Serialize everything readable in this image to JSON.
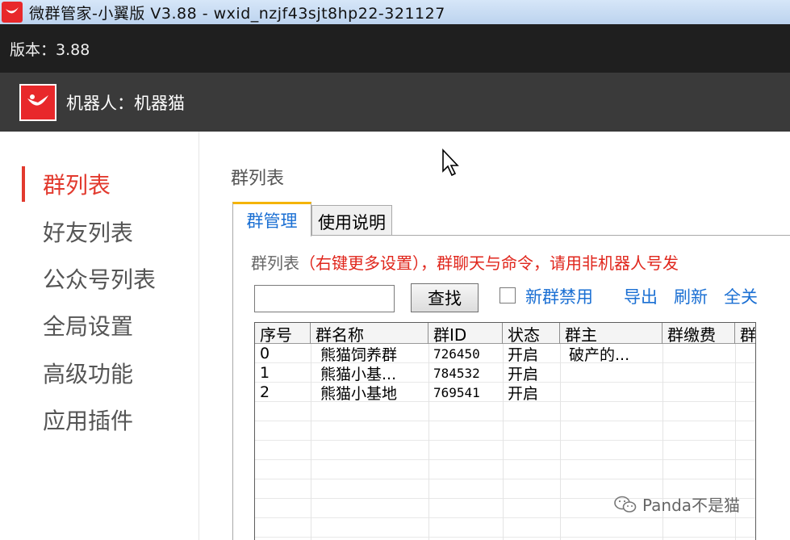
{
  "window": {
    "title": "微群管家-小翼版 V3.88 - wxid_nzjf43sjt8hp22-321127",
    "icon": "heart-logo-icon",
    "brand_color": "#e8282b"
  },
  "version_bar": {
    "label": "版本：3.88"
  },
  "robot_bar": {
    "label": "机器人：机器猫",
    "logo": "heart-logo-icon"
  },
  "sidebar": {
    "items": [
      {
        "label": "群列表",
        "active": true
      },
      {
        "label": "好友列表"
      },
      {
        "label": "公众号列表"
      },
      {
        "label": "全局设置"
      },
      {
        "label": "高级功能"
      },
      {
        "label": "应用插件"
      }
    ]
  },
  "main": {
    "title": "群列表",
    "tabs": [
      {
        "label": "群管理",
        "active": true
      },
      {
        "label": "使用说明"
      }
    ],
    "hint_prefix": "群列表",
    "hint_red": "（右键更多设置），群聊天与命令，请用非机器人号发",
    "search": {
      "value": "",
      "placeholder": ""
    },
    "find_label": "查找",
    "checkbox": {
      "label": "新群禁用",
      "checked": false
    },
    "links": {
      "export": "导出",
      "refresh": "刷新",
      "close_all": "全关"
    }
  },
  "table": {
    "columns": [
      "序号",
      "群名称",
      "群ID",
      "状态",
      "群主",
      "群缴费",
      "群"
    ],
    "rows": [
      [
        "0",
        "熊猫饲养群",
        "726450",
        "开启",
        "破产的...",
        "",
        ""
      ],
      [
        "1",
        "熊猫小基...",
        "784532",
        "开启",
        "",
        "",
        ""
      ],
      [
        "2",
        "熊猫小基地",
        "769541",
        "开启",
        "",
        "",
        ""
      ]
    ]
  },
  "watermark": {
    "text": "Panda不是猫",
    "icon": "wechat-icon"
  },
  "colors": {
    "accent_red": "#e23a2e",
    "link_blue": "#1a6fd3",
    "tab_top": "#f4b400"
  }
}
